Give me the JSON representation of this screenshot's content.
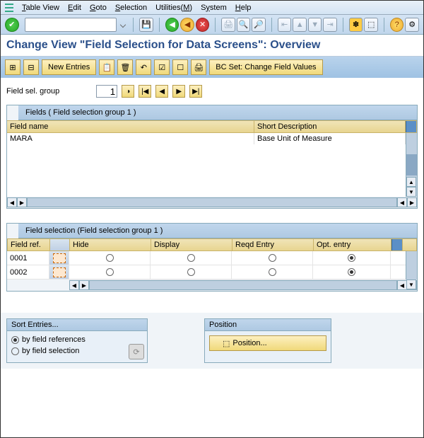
{
  "menu": {
    "items": [
      "Table View",
      "Edit",
      "Goto",
      "Selection",
      "Utilities(M)",
      "System",
      "Help"
    ]
  },
  "title": "Change View \"Field Selection for Data Screens\": Overview",
  "appbar": {
    "new_entries": "New Entries",
    "bc_set": "BC Set: Change Field Values"
  },
  "field_sel_group": {
    "label": "Field sel. group",
    "value": "1"
  },
  "panel1": {
    "title": "Fields  ( Field selection group    1 )",
    "columns": [
      "Field name",
      "Short Description"
    ],
    "rows": [
      {
        "field_name": "MARA",
        "short_desc": "Base Unit of Measure"
      }
    ]
  },
  "panel2": {
    "title": "Field selection (Field selection group    1 )",
    "columns": [
      "Field ref.",
      "",
      "Hide",
      "Display",
      "Reqd Entry",
      "Opt. entry"
    ],
    "rows": [
      {
        "ref": "0001",
        "hide": false,
        "display": false,
        "reqd": false,
        "opt": true
      },
      {
        "ref": "0002",
        "hide": false,
        "display": false,
        "reqd": false,
        "opt": true
      }
    ]
  },
  "sort": {
    "title": "Sort Entries...",
    "by_ref": "by field references",
    "by_sel": "by field selection",
    "selected": "by_ref"
  },
  "position": {
    "title": "Position",
    "button": "Position..."
  }
}
